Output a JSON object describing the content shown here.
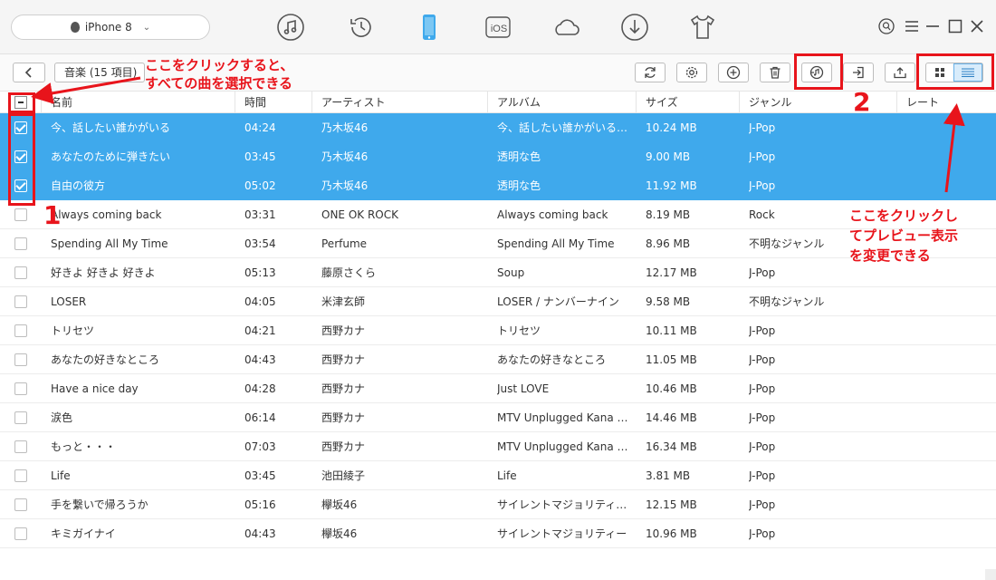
{
  "device": {
    "name": "iPhone 8"
  },
  "toolbar": {
    "folder_label": "音楽 (15 項目)"
  },
  "nav_icons": [
    "music-icon",
    "history-icon",
    "phone-icon",
    "ios-icon",
    "cloud-icon",
    "download-icon",
    "tshirt-icon"
  ],
  "nav_ios_text": "iOS",
  "columns": [
    "名前",
    "時間",
    "アーティスト",
    "アルバム",
    "サイズ",
    "ジャンル",
    "レート"
  ],
  "tracks": [
    {
      "name": "今、話したい誰かがいる",
      "time": "04:24",
      "artist": "乃木坂46",
      "album": "今、話したい誰かがいる (Sp...",
      "size": "10.24 MB",
      "genre": "J-Pop",
      "selected": true
    },
    {
      "name": "あなたのために弾きたい",
      "time": "03:45",
      "artist": "乃木坂46",
      "album": "透明な色",
      "size": "9.00 MB",
      "genre": "J-Pop",
      "selected": true
    },
    {
      "name": "自由の彼方",
      "time": "05:02",
      "artist": "乃木坂46",
      "album": "透明な色",
      "size": "11.92 MB",
      "genre": "J-Pop",
      "selected": true
    },
    {
      "name": "Always coming back",
      "time": "03:31",
      "artist": "ONE OK ROCK",
      "album": "Always coming back",
      "size": "8.19 MB",
      "genre": "Rock",
      "selected": false
    },
    {
      "name": "Spending All My Time",
      "time": "03:54",
      "artist": "Perfume",
      "album": "Spending All My Time",
      "size": "8.96 MB",
      "genre": "不明なジャンル",
      "selected": false
    },
    {
      "name": "好きよ 好きよ 好きよ",
      "time": "05:13",
      "artist": "藤原さくら",
      "album": "Soup",
      "size": "12.17 MB",
      "genre": "J-Pop",
      "selected": false
    },
    {
      "name": "LOSER",
      "time": "04:05",
      "artist": "米津玄師",
      "album": "LOSER / ナンバーナイン",
      "size": "9.58 MB",
      "genre": "不明なジャンル",
      "selected": false
    },
    {
      "name": "トリセツ",
      "time": "04:21",
      "artist": "西野カナ",
      "album": "トリセツ",
      "size": "10.11 MB",
      "genre": "J-Pop",
      "selected": false
    },
    {
      "name": "あなたの好きなところ",
      "time": "04:43",
      "artist": "西野カナ",
      "album": "あなたの好きなところ",
      "size": "11.05 MB",
      "genre": "J-Pop",
      "selected": false
    },
    {
      "name": "Have a nice day",
      "time": "04:28",
      "artist": "西野カナ",
      "album": "Just LOVE",
      "size": "10.46 MB",
      "genre": "J-Pop",
      "selected": false
    },
    {
      "name": "涙色",
      "time": "06:14",
      "artist": "西野カナ",
      "album": "MTV Unplugged Kana Ni...",
      "size": "14.46 MB",
      "genre": "J-Pop",
      "selected": false
    },
    {
      "name": "もっと・・・",
      "time": "07:03",
      "artist": "西野カナ",
      "album": "MTV Unplugged Kana Ni...",
      "size": "16.34 MB",
      "genre": "J-Pop",
      "selected": false
    },
    {
      "name": "Life",
      "time": "03:45",
      "artist": "池田綾子",
      "album": "Life",
      "size": "3.81 MB",
      "genre": "J-Pop",
      "selected": false
    },
    {
      "name": "手を繋いで帰ろうか",
      "time": "05:16",
      "artist": "欅坂46",
      "album": "サイレントマジョリティー (Spec...",
      "size": "12.15 MB",
      "genre": "J-Pop",
      "selected": false
    },
    {
      "name": "キミガイナイ",
      "time": "04:43",
      "artist": "欅坂46",
      "album": "サイレントマジョリティー",
      "size": "10.96 MB",
      "genre": "J-Pop",
      "selected": false
    }
  ],
  "annotations": {
    "select_all_line1": "ここをクリックすると、",
    "select_all_line2": "すべての曲を選択できる",
    "num1": "1",
    "num2": "2",
    "preview_line1": "ここをクリックし",
    "preview_line2": "てプレビュー表示",
    "preview_line3": "を変更できる"
  },
  "colors": {
    "selection": "#3fa9ec",
    "annotation": "#e8141b"
  }
}
